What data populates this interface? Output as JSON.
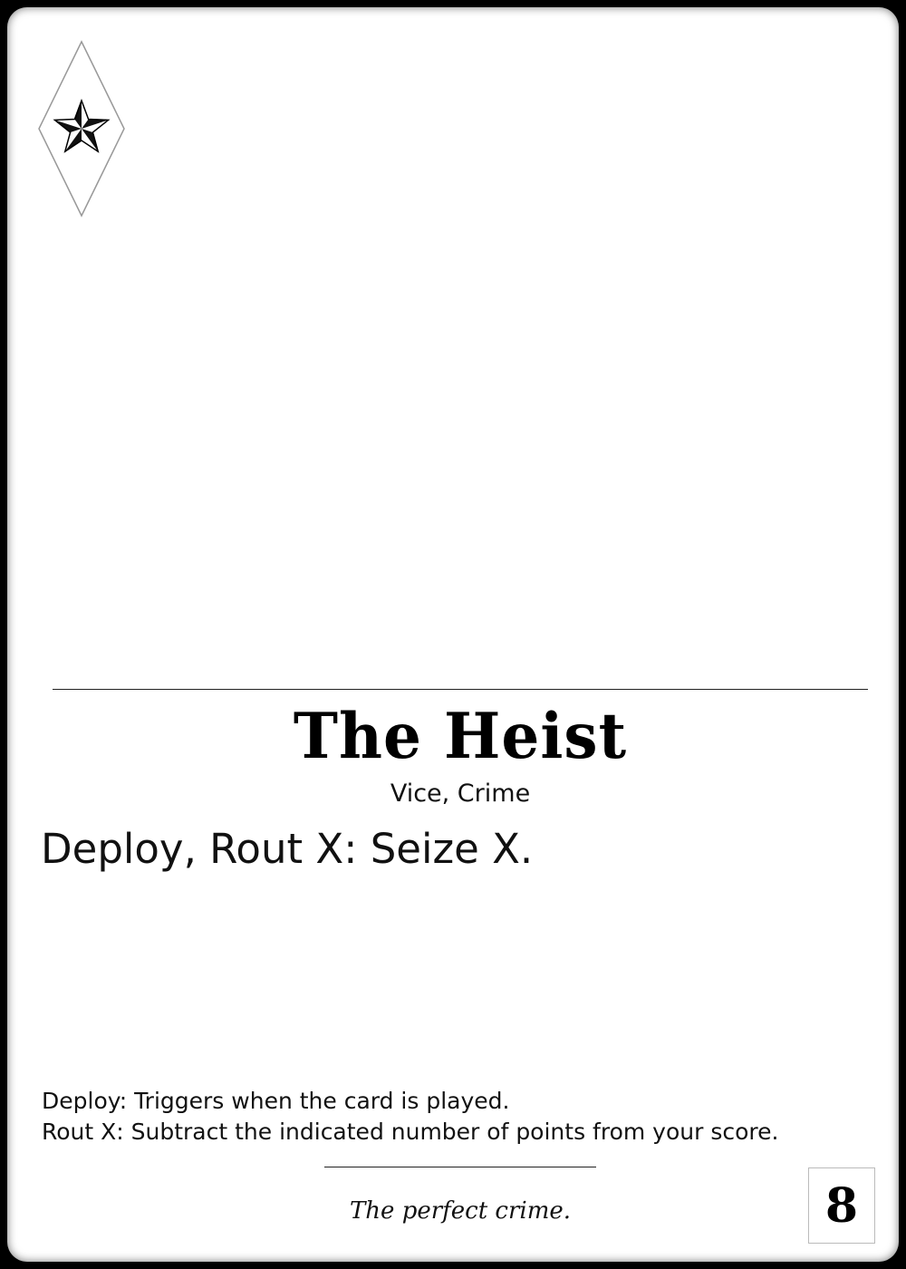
{
  "card": {
    "title": "The Heist",
    "types": "Vice, Crime",
    "ability": "Deploy, Rout X: Seize X.",
    "glossary": [
      "Deploy: Triggers when the card is played.",
      "Rout X: Subtract the indicated number of points from your score."
    ],
    "flavor": "The perfect crime.",
    "cost": "8",
    "suit_icon": "star-icon"
  }
}
